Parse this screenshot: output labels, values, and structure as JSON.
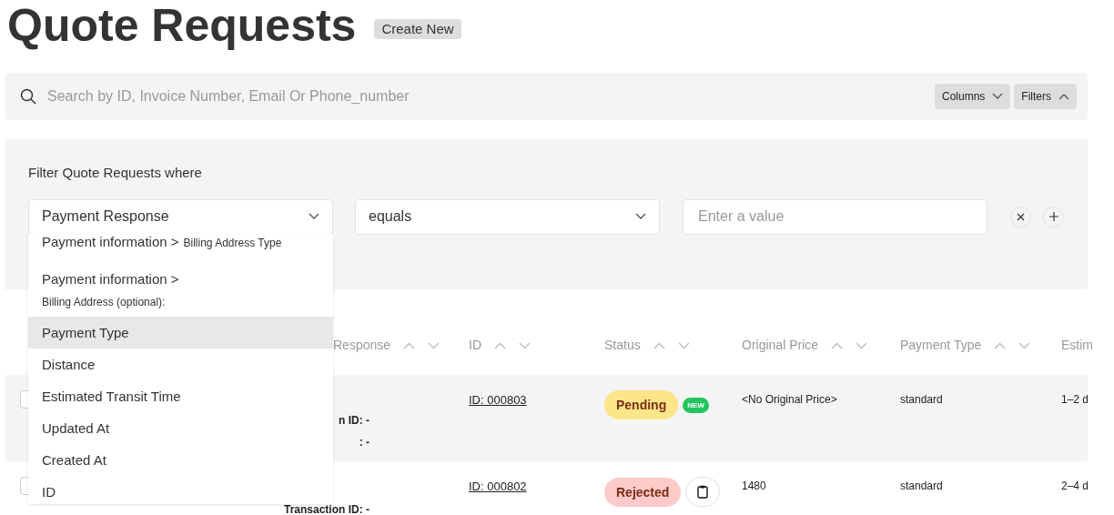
{
  "page": {
    "title": "Quote Requests",
    "create_button": "Create New"
  },
  "search": {
    "placeholder": "Search by ID, Invoice Number, Email Or Phone_number",
    "columns_button": "Columns",
    "filters_button": "Filters"
  },
  "filter": {
    "label": "Filter Quote Requests where",
    "field": "Payment Response",
    "operator": "equals",
    "value_placeholder": "Enter a value",
    "options": [
      {
        "kind": "path",
        "parent": "Payment information >",
        "child": "Billing Address Type",
        "selected": false
      },
      {
        "kind": "path_wrapped",
        "parent": "Payment information >",
        "child": "Billing Address (optional):",
        "selected": false
      },
      {
        "kind": "plain",
        "label": "Payment Type",
        "selected": true
      },
      {
        "kind": "plain",
        "label": "Distance",
        "selected": false
      },
      {
        "kind": "plain",
        "label": "Estimated Transit Time",
        "selected": false
      },
      {
        "kind": "plain",
        "label": "Updated At",
        "selected": false
      },
      {
        "kind": "plain",
        "label": "Created At",
        "selected": false
      },
      {
        "kind": "plain",
        "label": "ID",
        "selected": false
      }
    ]
  },
  "table": {
    "columns": [
      "Response",
      "ID",
      "Status",
      "Original Price",
      "Payment Type",
      "Estim"
    ],
    "rows": [
      {
        "response_lines": [
          "n ID: -",
          ": -"
        ],
        "id": "ID: 000803",
        "checked": false,
        "status": "Pending",
        "color": "#fde68a",
        "badge": "NEW",
        "action": false,
        "original_price": "<No Original Price>",
        "payment_type": "standard",
        "column_6": "1–2 d"
      },
      {
        "response_lines": [
          "Transaction ID: -"
        ],
        "id": "ID: 000802",
        "checked": false,
        "status": "Rejected",
        "color": "#fecaca",
        "action": true,
        "original_price": "1480",
        "payment_type": "standard",
        "column_6": "2–4 d"
      }
    ]
  }
}
